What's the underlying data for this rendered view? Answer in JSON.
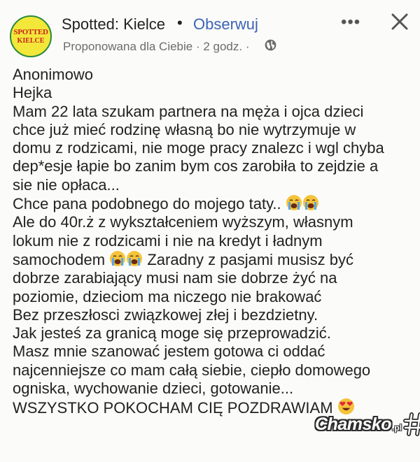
{
  "header": {
    "avatar_text_line1": "SPOTTED",
    "avatar_text_line2": "KIELCE",
    "page_name": "Spotted: Kielce",
    "separator": "•",
    "follow_label": "Obserwuj",
    "subtitle": "Proponowana dla Ciebie · 2 godz. ·",
    "more_label": "•••",
    "icons": {
      "privacy": "globe-icon",
      "close": "close-icon"
    }
  },
  "post": {
    "lines": [
      "Anonimowo",
      "Hejka",
      "Mam 22 lata szukam partnera na męża i ojca dzieci",
      "chce już mieć rodzinę własną bo nie wytrzymuje w",
      "domu z rodzicami, nie moge pracy znalezc i wgl chyba",
      "dep*esje łapie bo zanim bym cos zarobiła to zejdzie a",
      "sie nie opłaca...",
      "Chce pana podobnego do mojego taty..",
      "Ale do 40r.ż z wykształceniem wyższym, własnym",
      "lokum nie z rodzicami i nie na kredyt i ładnym",
      "samochodem",
      "Zaradny z pasjami musisz być",
      "dobrze zarabiający musi nam sie dobrze żyć na",
      "poziomie, dzieciom ma niczego nie brakować",
      "Bez przeszłosci związkowej złej i bezdzietny.",
      "Jak jesteś za granicą moge się przeprowadzić.",
      "Masz mnie szanować jestem gotowa ci oddać",
      "najcenniejsze co mam całą siebie, ciepło domowego",
      "ogniska, wychowanie dzieci, gotowanie...",
      "WSZYSTKO POKOCHAM CIĘ POZDRAWIAM"
    ],
    "emojis": {
      "crying": "loudly-crying-face-emoji",
      "love": "heart-eyes-emoji"
    }
  },
  "watermark": {
    "text": "Chamsko",
    "suffix": ".pl"
  }
}
